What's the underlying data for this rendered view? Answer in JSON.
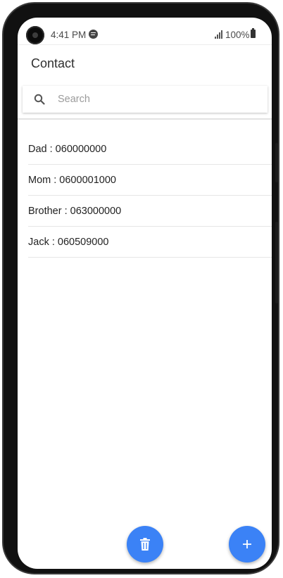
{
  "status_bar": {
    "time": "4:41 PM",
    "battery": "100%",
    "icons": [
      "spotify-icon",
      "signal-icon",
      "battery-icon"
    ]
  },
  "app": {
    "title": "Contact"
  },
  "search": {
    "placeholder": "Search",
    "value": ""
  },
  "contacts": [
    {
      "label": "Dad : 060000000"
    },
    {
      "label": "Mom : 0600001000"
    },
    {
      "label": "Brother : 063000000"
    },
    {
      "label": "Jack : 060509000"
    }
  ],
  "actions": {
    "delete_icon": "trash-icon",
    "add_icon": "plus-icon"
  },
  "colors": {
    "accent": "#3b82f6"
  }
}
